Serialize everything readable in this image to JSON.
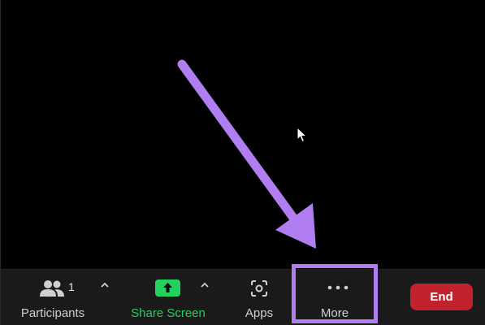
{
  "toolbar": {
    "participants": {
      "label": "Participants",
      "count": "1",
      "icon": "people-icon"
    },
    "share_screen": {
      "label": "Share Screen",
      "icon": "share-up-arrow-icon",
      "accent": "#23d160"
    },
    "apps": {
      "label": "Apps",
      "icon": "apps-icon"
    },
    "more": {
      "label": "More",
      "icon": "ellipsis-icon"
    },
    "end": {
      "label": "End",
      "color": "#c1222b"
    }
  },
  "annotation": {
    "arrow_color": "#b07ef0",
    "highlight_color": "#b07ef0"
  }
}
